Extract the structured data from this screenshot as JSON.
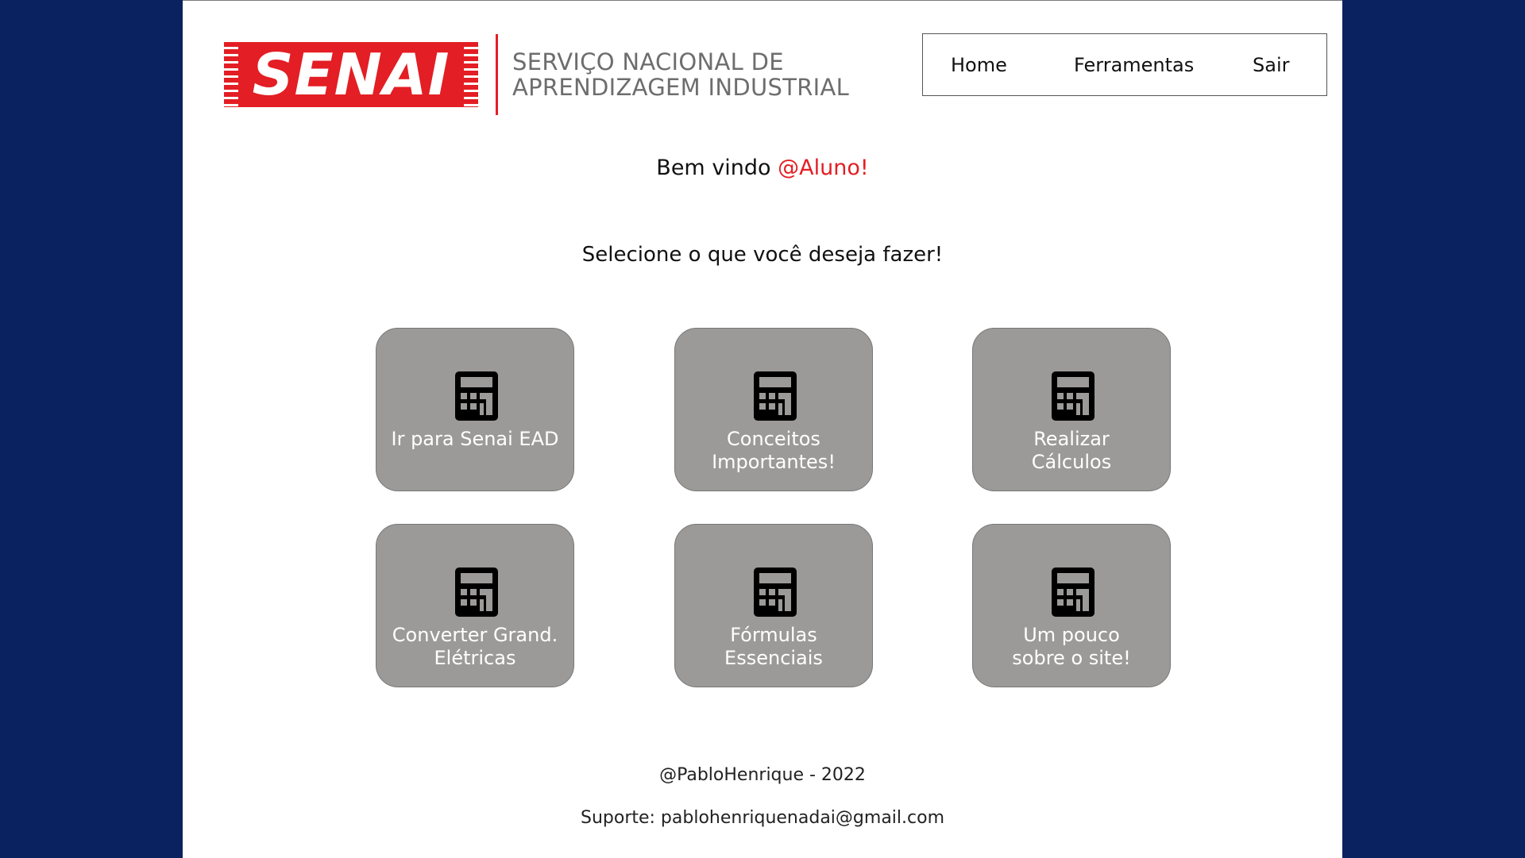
{
  "header": {
    "logo_text": "SENAI",
    "org_line1": "SERVIÇO NACIONAL DE",
    "org_line2": "APRENDIZAGEM INDUSTRIAL",
    "nav": {
      "home": "Home",
      "tools": "Ferramentas",
      "exit": "Sair"
    }
  },
  "main": {
    "welcome_prefix": "Bem vindo ",
    "welcome_user": "@Aluno!",
    "prompt": "Selecione o que você deseja fazer!",
    "cards": [
      {
        "label": "Ir para Senai EAD",
        "icon": "calculator-icon"
      },
      {
        "label": "Conceitos\nImportantes!",
        "icon": "calculator-icon"
      },
      {
        "label": "Realizar\nCálculos",
        "icon": "calculator-icon"
      },
      {
        "label": "Converter Grand.\nElétricas",
        "icon": "calculator-icon"
      },
      {
        "label": "Fórmulas\nEssenciais",
        "icon": "calculator-icon"
      },
      {
        "label": "Um pouco\nsobre o site!",
        "icon": "calculator-icon"
      }
    ]
  },
  "footer": {
    "credit": "@PabloHenrique - 2022",
    "support": "Suporte: pablohenriquenadai@gmail.com"
  },
  "colors": {
    "background": "#0b2260",
    "brand_red": "#e31e24",
    "card": "#9b9a99"
  }
}
